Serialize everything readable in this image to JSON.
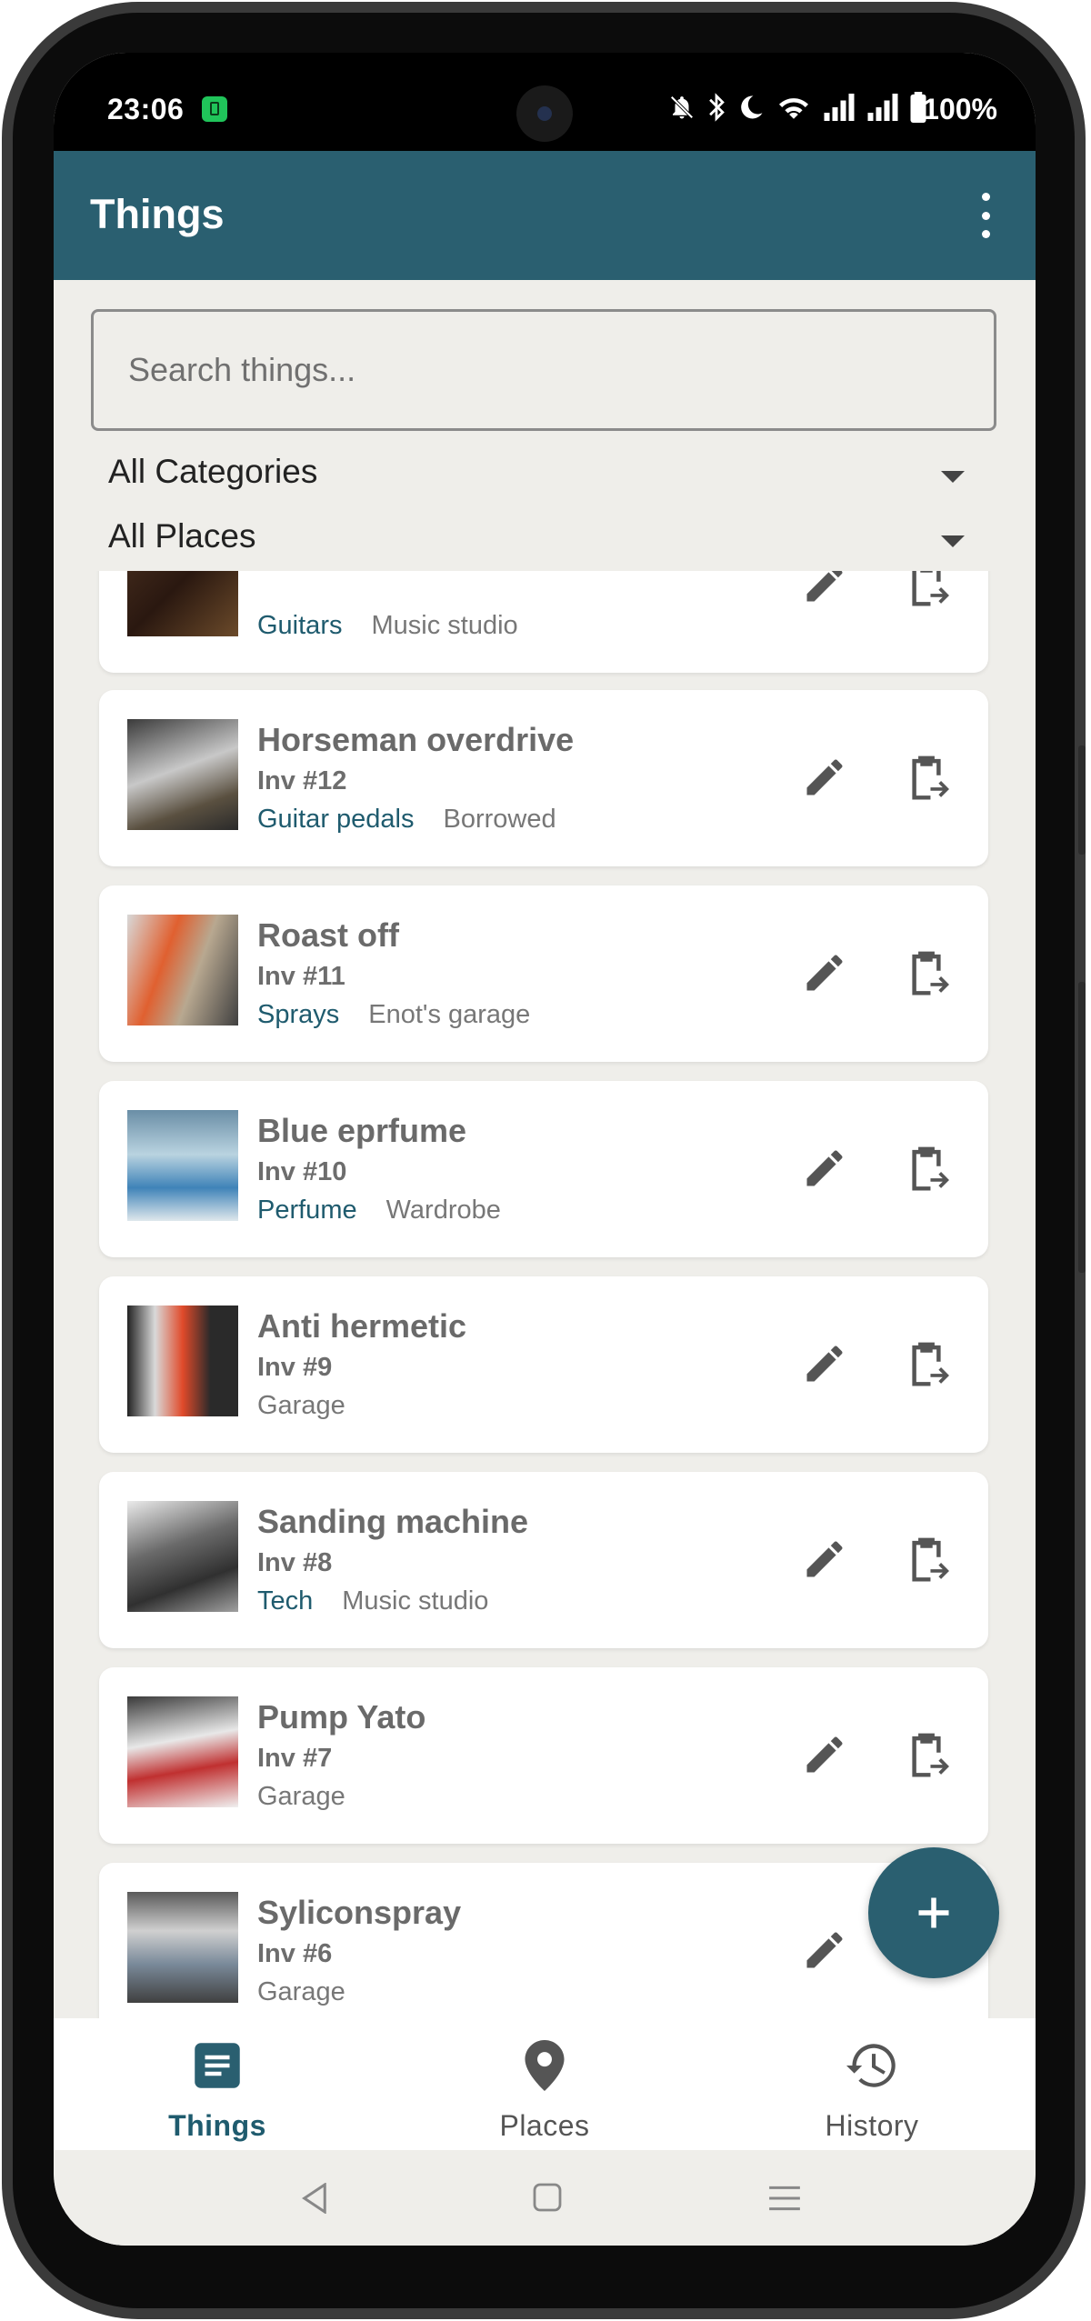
{
  "status_bar": {
    "time": "23:06",
    "battery_percent": "100%"
  },
  "app_bar": {
    "title": "Things",
    "menu_icon": "more-vert-icon"
  },
  "search": {
    "placeholder": "Search things..."
  },
  "filters": {
    "category": "All Categories",
    "place": "All Places"
  },
  "partial_item": {
    "category": "Guitars",
    "place": "Music studio"
  },
  "items": [
    {
      "name": "Horseman overdrive",
      "inv": "Inv #12",
      "category": "Guitar pedals",
      "place": "Borrowed"
    },
    {
      "name": "Roast off",
      "inv": "Inv #11",
      "category": "Sprays",
      "place": "Enot's garage"
    },
    {
      "name": "Blue eprfume",
      "inv": "Inv #10",
      "category": "Perfume",
      "place": "Wardrobe"
    },
    {
      "name": "Anti hermetic",
      "inv": "Inv #9",
      "category": "",
      "place": "Garage"
    },
    {
      "name": "Sanding machine",
      "inv": "Inv #8",
      "category": "Tech",
      "place": "Music studio"
    },
    {
      "name": "Pump Yato",
      "inv": "Inv #7",
      "category": "",
      "place": "Garage"
    },
    {
      "name": "Syliconspray",
      "inv": "Inv #6",
      "category": "",
      "place": "Garage"
    }
  ],
  "fab": {
    "icon": "plus-icon"
  },
  "bottom_nav": [
    {
      "label": "Things",
      "icon": "list-icon",
      "active": true
    },
    {
      "label": "Places",
      "icon": "map-pin-icon",
      "active": false
    },
    {
      "label": "History",
      "icon": "history-icon",
      "active": false
    }
  ],
  "colors": {
    "primary": "#2a5f70",
    "background": "#efeeea",
    "category_text": "#1f5b6e"
  }
}
